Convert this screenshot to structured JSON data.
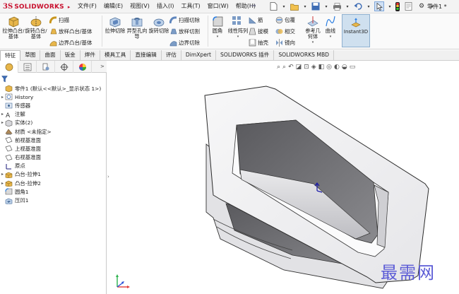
{
  "app": {
    "logo_ds": "3S",
    "logo_text": "SOLIDWORKS",
    "part_name": "零件1 *"
  },
  "menu": [
    "文件(F)",
    "编辑(E)",
    "视图(V)",
    "插入(I)",
    "工具(T)",
    "窗口(W)",
    "帮助(H)"
  ],
  "commands": {
    "extrude_boss": "拉伸凸台/基体",
    "revolve_boss": "旋转凸台/基体",
    "sweep": "扫描",
    "loft_boss": "放样凸台/基体",
    "boundary_boss": "边界凸台/基体",
    "extrude_cut": "拉伸切除",
    "hole_wizard": "异型孔向导",
    "revolve_cut": "旋转切除",
    "sweep_cut": "扫描切除",
    "loft_cut": "放样切割",
    "boundary_cut": "边界切除",
    "fillet": "圆角",
    "linear_pattern": "线性阵列",
    "rib": "筋",
    "draft": "拔模",
    "shell": "抽壳",
    "wrap": "包覆",
    "intersect": "相交",
    "mirror": "镜向",
    "reference_geometry": "参考几何体",
    "curves": "曲线",
    "instant3d": "Instant3D"
  },
  "tabs": [
    "特征",
    "草图",
    "曲面",
    "钣金",
    "焊件",
    "模具工具",
    "直接编辑",
    "评估",
    "DimXpert",
    "SOLIDWORKS 插件",
    "SOLIDWORKS MBD"
  ],
  "active_tab": "特征",
  "tree": {
    "root": "零件1 (默认<<默认>_显示状态 1>)",
    "items": [
      {
        "label": "History",
        "icon": "history-icon",
        "expand": "▸"
      },
      {
        "label": "传感器",
        "icon": "sensor-icon",
        "expand": ""
      },
      {
        "label": "注解",
        "icon": "annotation-icon",
        "expand": "▸"
      },
      {
        "label": "实体(2)",
        "icon": "solid-bodies-icon",
        "expand": "▸"
      },
      {
        "label": "材质 <未指定>",
        "icon": "material-icon",
        "expand": ""
      },
      {
        "label": "前视基准面",
        "icon": "plane-icon",
        "expand": ""
      },
      {
        "label": "上视基准面",
        "icon": "plane-icon",
        "expand": ""
      },
      {
        "label": "右视基准面",
        "icon": "plane-icon",
        "expand": ""
      },
      {
        "label": "原点",
        "icon": "origin-icon",
        "expand": ""
      },
      {
        "label": "凸台-拉伸1",
        "icon": "extrude-feature-icon",
        "expand": "▸"
      },
      {
        "label": "凸台-拉伸2",
        "icon": "extrude-feature-icon",
        "expand": "▸"
      },
      {
        "label": "圆角1",
        "icon": "fillet-feature-icon",
        "expand": ""
      },
      {
        "label": "压凹1",
        "icon": "indent-feature-icon",
        "expand": ""
      }
    ]
  },
  "watermark": "最需网",
  "colors": {
    "brand": "#c8102e",
    "accent": "#1f5fbf",
    "selected_tab": "#ffffff",
    "instant3d_bg": "#cfe0ef"
  }
}
